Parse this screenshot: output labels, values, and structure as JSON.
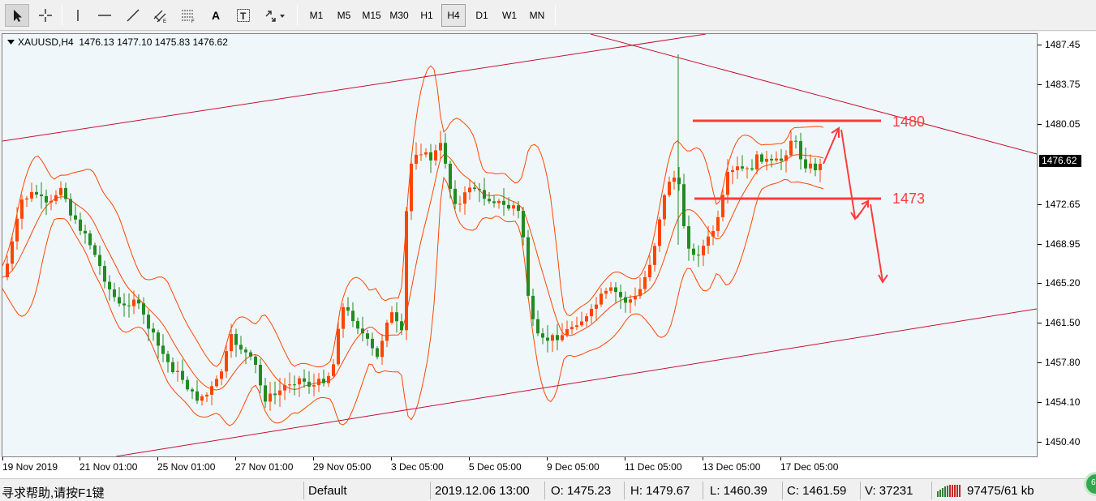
{
  "toolbar": {
    "tools": [
      {
        "name": "cursor-icon",
        "glyph": "⮝"
      },
      {
        "name": "crosshair-icon",
        "glyph": "┼"
      },
      {
        "name": "vertical-line-icon",
        "glyph": "|"
      },
      {
        "name": "horizontal-line-icon",
        "glyph": "—"
      },
      {
        "name": "trendline-icon",
        "glyph": "╱"
      },
      {
        "name": "channel-icon",
        "glyph": "⫻"
      },
      {
        "name": "fibonacci-icon",
        "glyph": "☰"
      },
      {
        "name": "text-icon",
        "glyph": "A"
      },
      {
        "name": "text-label-icon",
        "glyph": "T"
      },
      {
        "name": "arrows-menu-icon",
        "glyph": "⬉▾"
      }
    ],
    "timeframes": [
      "M1",
      "M5",
      "M15",
      "M30",
      "H1",
      "H4",
      "D1",
      "W1",
      "MN"
    ],
    "selected_timeframe": "H4"
  },
  "chart": {
    "symbol_info": "XAUUSD,H4  1476.13 1477.10 1475.83 1476.62",
    "current_price": "1476.62",
    "price_labels": [
      "1487.45",
      "1483.75",
      "1480.05",
      "1476.35",
      "1472.65",
      "1468.95",
      "1465.20",
      "1461.50",
      "1457.80",
      "1454.10",
      "1450.40"
    ],
    "time_labels": [
      "19 Nov 2019",
      "21 Nov 01:00",
      "25 Nov 01:00",
      "27 Nov 01:00",
      "29 Nov 05:00",
      "3 Dec 05:00",
      "5 Dec 05:00",
      "9 Dec 05:00",
      "11 Dec 05:00",
      "13 Dec 05:00",
      "17 Dec 05:00"
    ],
    "level_labels": {
      "upper": "1480",
      "lower": "1473"
    },
    "colors": {
      "bull": "#ff4500",
      "bear": "#228b22",
      "bands": "#ff4500",
      "channel": "#c8102e",
      "levels": "#ff3b3b",
      "background": "#eff7fb"
    }
  },
  "status": {
    "help": "寻求帮助,请按F1键",
    "profile": "Default",
    "datetime": "2019.12.06 13:00",
    "open": "O: 1475.23",
    "high": "H: 1479.67",
    "low": "L: 1460.39",
    "close": "C: 1461.59",
    "volume": "V: 37231",
    "traffic": "97475/61 kb"
  }
}
